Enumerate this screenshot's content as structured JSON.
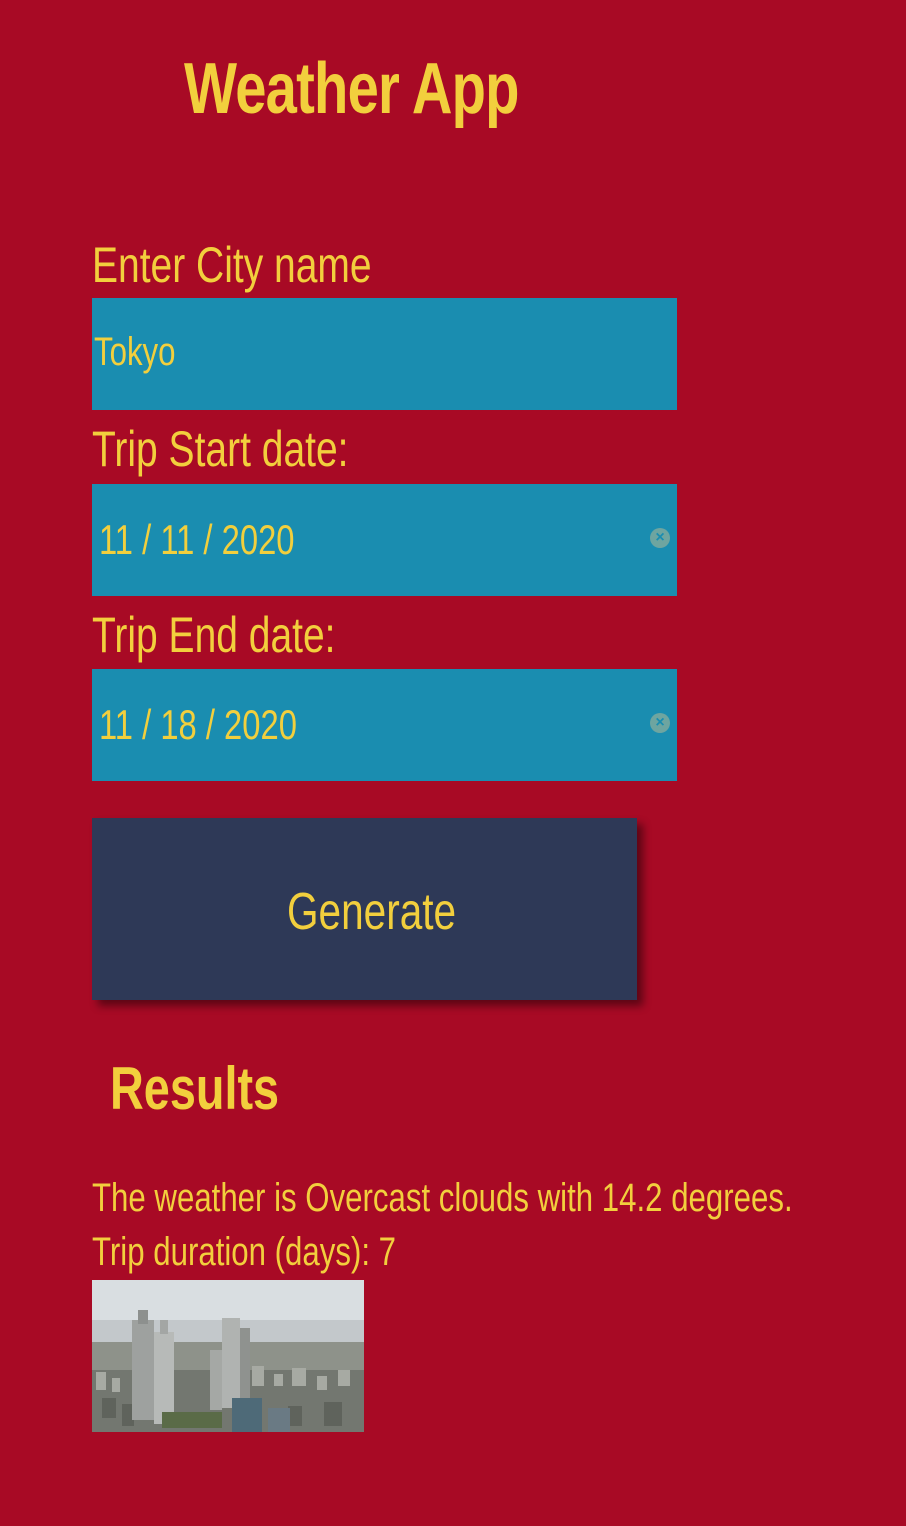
{
  "header": {
    "title": "Weather App"
  },
  "form": {
    "city_label": "Enter City name",
    "city_value": "Tokyo",
    "start_label": "Trip Start date:",
    "start_value": "11 / 11 / 2020",
    "end_label": "Trip End date:",
    "end_value": "11 / 18 / 2020",
    "generate_label": "Generate"
  },
  "results": {
    "title": "Results",
    "weather_text": "The weather is Overcast clouds with 14.2 degrees.",
    "duration_text": "Trip duration (days): 7",
    "image_icon": "city-skyline-photo"
  },
  "colors": {
    "background": "#a80a25",
    "text": "#f2cf3d",
    "input_bg": "#1a8db0",
    "button_bg": "#2e3957"
  }
}
